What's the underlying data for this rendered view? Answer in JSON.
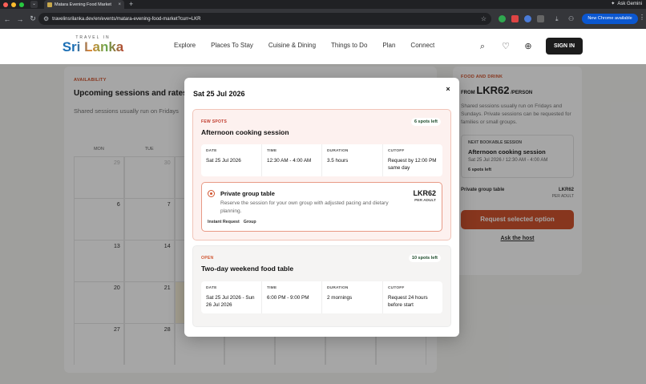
{
  "browser": {
    "tab_title": "Matara Evening Food Market",
    "url": "travelinsrilanka.dev/en/events/matara-evening-food-market?curr=LKR",
    "new_chrome": "New Chrome available",
    "ask_gemini": "Ask Gemini"
  },
  "site": {
    "logo_top": "TRAVEL IN",
    "logo_main": "Sri Lanka",
    "nav": [
      "Explore",
      "Places To Stay",
      "Cuisine & Dining",
      "Things to Do",
      "Plan",
      "Connect"
    ],
    "sign_in": "SIGN IN"
  },
  "availability": {
    "eyebrow": "AVAILABILITY",
    "title": "Upcoming sessions and rates",
    "subtitle": "Shared sessions usually run on Fridays",
    "weekdays": [
      "MON",
      "TUE",
      "",
      "",
      "",
      "",
      ""
    ],
    "rows": [
      [
        "29",
        "30",
        "",
        "",
        "",
        "",
        ""
      ],
      [
        "6",
        "7",
        "",
        "",
        "",
        "",
        ""
      ],
      [
        "13",
        "14",
        "",
        "",
        "",
        "",
        ""
      ],
      [
        "20",
        "21",
        "",
        "",
        "",
        "",
        ""
      ],
      [
        "27",
        "28",
        "",
        "",
        "",
        "",
        ""
      ]
    ]
  },
  "side": {
    "eyebrow": "FOOD AND DRINK",
    "from": "FROM",
    "price": "LKR62",
    "per": "/PERSON",
    "desc": "Shared sessions usually run on Fridays and Sundays. Private sessions can be requested for families or small groups.",
    "next_label": "NEXT BOOKABLE SESSION",
    "next_title": "Afternoon cooking session",
    "next_time": "Sat 25 Jul 2026 / 12:30 AM - 4:00 AM",
    "next_spots": "6 spots left",
    "row_label": "Private group table",
    "row_price": "LKR62",
    "row_unit": "PER ADULT",
    "request": "Request selected option",
    "ask_host": "Ask the host"
  },
  "modal": {
    "title": "Sat 25 Jul 2026",
    "close": "×",
    "sessions": [
      {
        "badge": "FEW SPOTS",
        "spots": "6 spots left",
        "title": "Afternoon cooking session",
        "info": [
          {
            "label": "DATE",
            "value": "Sat 25 Jul 2026"
          },
          {
            "label": "TIME",
            "value": "12:30 AM - 4:00 AM"
          },
          {
            "label": "DURATION",
            "value": "3.5 hours"
          },
          {
            "label": "CUTOFF",
            "value": "Request by 12:00 PM same day"
          }
        ],
        "option": {
          "title": "Private group table",
          "desc": "Reserve the session for your own group with adjusted pacing and dietary planning.",
          "price": "LKR62",
          "unit": "PER ADULT",
          "tags": [
            "Instant Request",
            "Group"
          ]
        }
      },
      {
        "badge": "OPEN",
        "spots": "10 spots left",
        "title": "Two-day weekend food table",
        "info": [
          {
            "label": "DATE",
            "value": "Sat 25 Jul 2026 - Sun 26 Jul 2026"
          },
          {
            "label": "TIME",
            "value": "6:00 PM - 9:00 PM"
          },
          {
            "label": "DURATION",
            "value": "2 mornings"
          },
          {
            "label": "CUTOFF",
            "value": "Request 24 hours before start"
          }
        ]
      }
    ]
  }
}
